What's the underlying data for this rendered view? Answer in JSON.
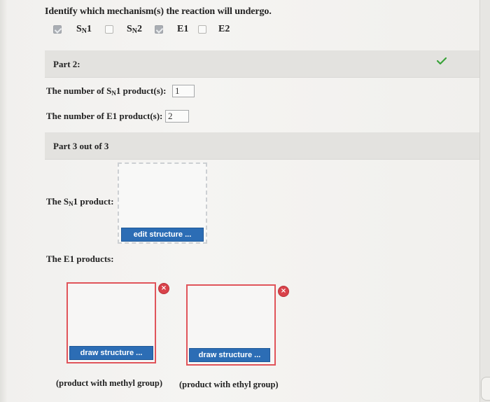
{
  "question": "Identify which mechanism(s) the reaction will undergo.",
  "mechanisms": [
    {
      "base": "S",
      "sub": "N",
      "num": "1",
      "checked": true
    },
    {
      "base": "S",
      "sub": "N",
      "num": "2",
      "checked": false
    },
    {
      "base": "E1",
      "sub": "",
      "num": "",
      "checked": true
    },
    {
      "base": "E2",
      "sub": "",
      "num": "",
      "checked": false
    }
  ],
  "part2": {
    "label": "Part 2:",
    "sn1_count": {
      "prefix": "The number of S",
      "sub": "N",
      "suffix": "1 product(s):",
      "value": "1"
    },
    "e1_count": {
      "label": "The number of E1 product(s):",
      "value": "2"
    }
  },
  "part3": {
    "label": "Part 3 out of 3",
    "sn1_product": {
      "prefix": "The S",
      "sub": "N",
      "suffix": "1 product:",
      "button": "edit structure ..."
    },
    "e1_products": {
      "label": "The E1 products:",
      "items": [
        {
          "button": "draw structure ...",
          "caption": "(product with methyl group)",
          "remove": "×"
        },
        {
          "button": "draw structure ...",
          "caption": "(product with ethyl group)",
          "remove": "×"
        }
      ]
    }
  },
  "colors": {
    "accent_button": "#2c6db5",
    "success_check": "#3aa33a",
    "error_border": "#e0545a"
  }
}
